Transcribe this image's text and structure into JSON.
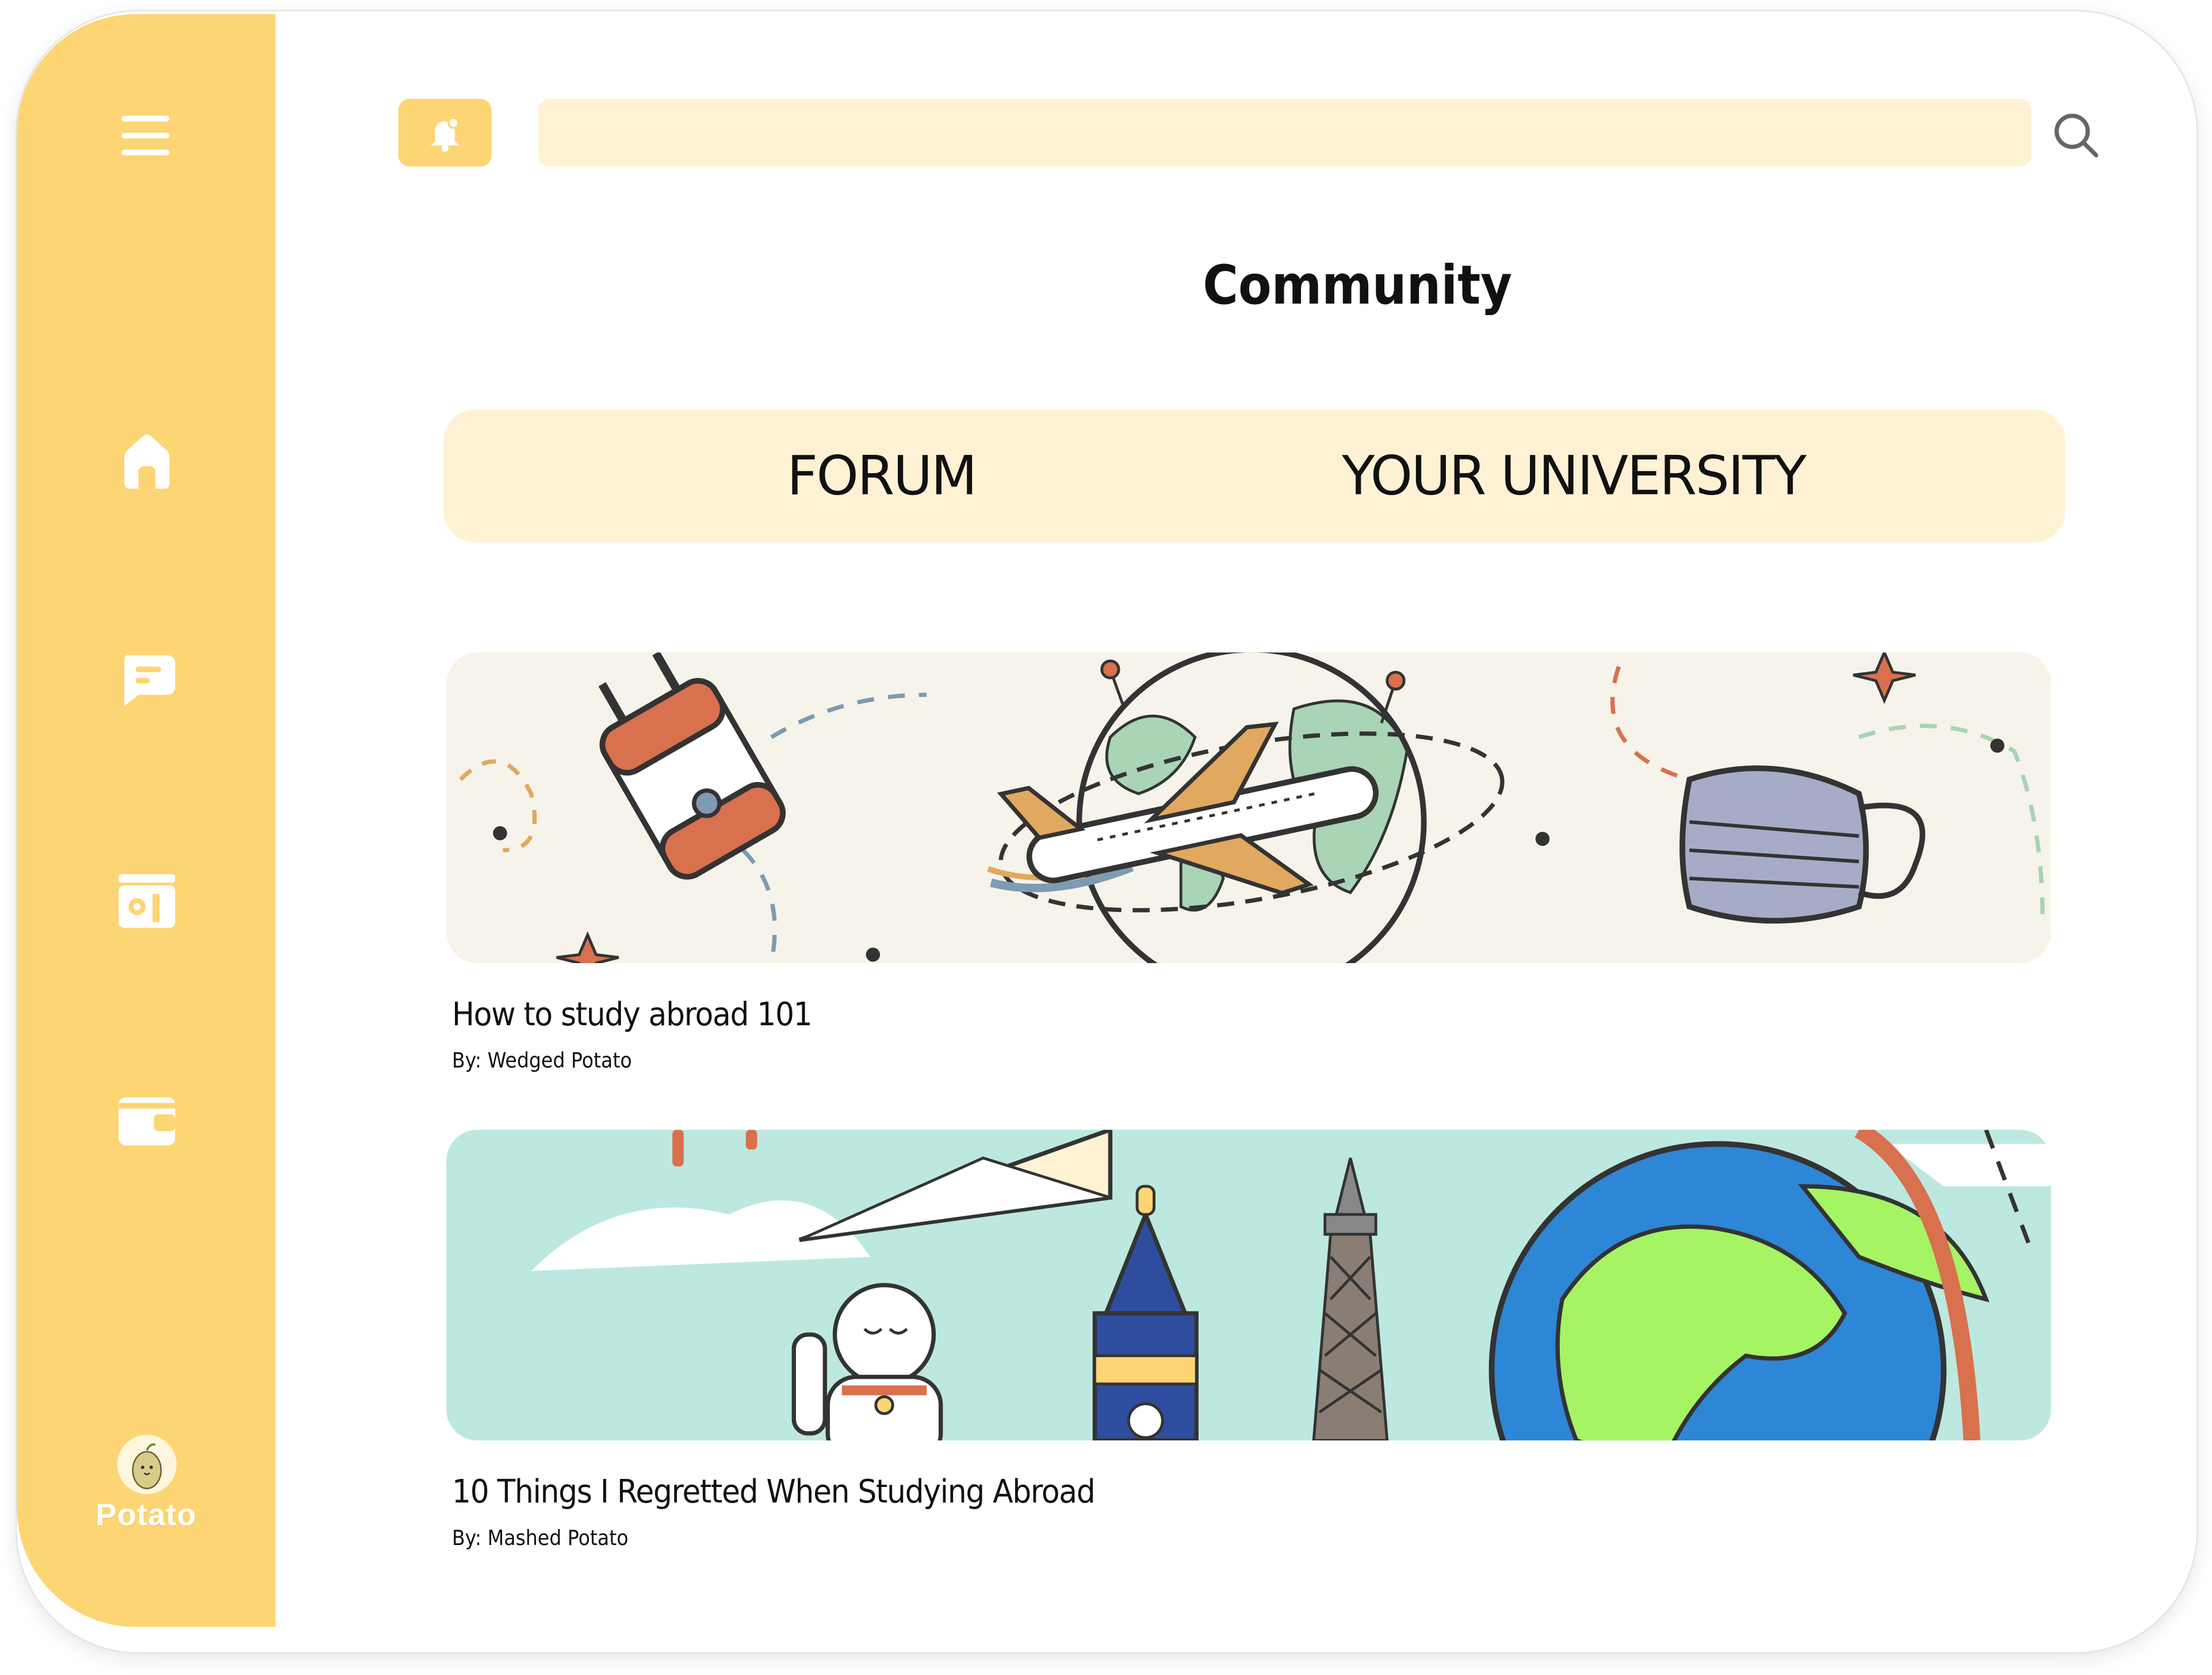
{
  "app": {
    "accent_color": "#fed574",
    "accent_light": "#fff2d4"
  },
  "sidebar": {
    "items": [
      {
        "name": "menu",
        "icon": "hamburger-menu-icon"
      },
      {
        "name": "home",
        "icon": "home-icon"
      },
      {
        "name": "chat",
        "icon": "chat-bubble-icon"
      },
      {
        "name": "wallet-photo",
        "icon": "photo-card-icon"
      },
      {
        "name": "wallet",
        "icon": "wallet-icon"
      }
    ],
    "profile": {
      "name": "Potato",
      "avatar_icon": "potato-avatar-icon"
    }
  },
  "topbar": {
    "notification_icon": "bell-icon",
    "search_placeholder": "",
    "search_value": "",
    "search_icon": "magnifier-icon"
  },
  "page": {
    "title": "Community"
  },
  "tabs": [
    {
      "label": "FORUM"
    },
    {
      "label": "YOUR UNIVERSITY"
    }
  ],
  "posts": [
    {
      "title": "How to study abroad 101",
      "author": "By: Wedged Potato",
      "illustration": "travel-globe-airplane-illustration"
    },
    {
      "title": "10 Things I Regretted When Studying Abroad",
      "author": "By: Mashed Potato",
      "illustration": "world-landmarks-globe-illustration"
    }
  ]
}
